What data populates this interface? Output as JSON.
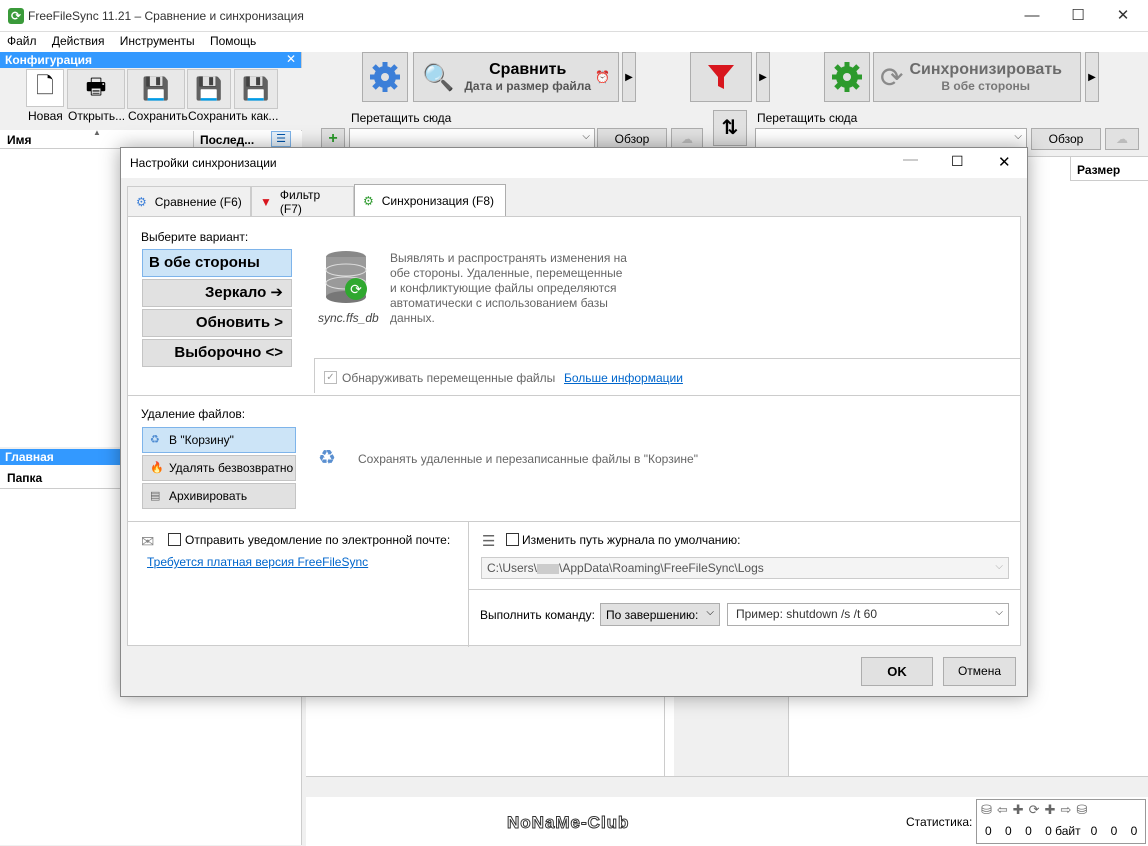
{
  "window": {
    "title": "FreeFileSync 11.21 – Сравнение и синхронизация",
    "minimize": "—",
    "maximize": "☐",
    "close": "✕"
  },
  "menu": [
    "Файл",
    "Действия",
    "Инструменты",
    "Помощь"
  ],
  "config": {
    "title": "Конфигурация",
    "close": "✕",
    "buttons": [
      {
        "label": "Новая"
      },
      {
        "label": "Открыть..."
      },
      {
        "label": "Сохранить"
      },
      {
        "label": "Сохранить как..."
      }
    ],
    "col_name": "Имя",
    "col_last": "Послед..."
  },
  "main_panel": {
    "title": "Главная",
    "col_folder": "Папка"
  },
  "toolbar": {
    "compare_title": "Сравнить",
    "compare_sub": "Дата и размер файла",
    "sync_title": "Синхронизировать",
    "sync_sub": "В обе стороны"
  },
  "left_folder": {
    "drop_label": "Перетащить сюда",
    "browse": "Обзор"
  },
  "right_folder": {
    "drop_label": "Перетащить сюда",
    "browse": "Обзор"
  },
  "grid": {
    "col_size": "Размер"
  },
  "status": {
    "label": "Статистика:",
    "counts": [
      "0",
      "0",
      "0",
      "0 байт",
      "0",
      "0",
      "0"
    ]
  },
  "watermark": "NoNaMe-Club",
  "dialog": {
    "title": "Настройки синхронизации",
    "tabs": [
      {
        "label": "Сравнение (F6)"
      },
      {
        "label": "Фильтр (F7)"
      },
      {
        "label": "Синхронизация (F8)"
      }
    ],
    "variant_label": "Выберите вариант:",
    "variants": [
      {
        "label": "В обе стороны ⟷"
      },
      {
        "label": "Зеркало ➔"
      },
      {
        "label": "Обновить >"
      },
      {
        "label": "Выборочно <>"
      }
    ],
    "db_name": "sync.ffs_db",
    "description": "Выявлять и распространять изменения на обе стороны. Удаленные, перемещенные и конфликтующие файлы определяются автоматически с использованием базы данных.",
    "detect_moved": "Обнаруживать перемещенные файлы",
    "more_info": "Больше информации",
    "delete_label": "Удаление файлов:",
    "delete_options": [
      {
        "label": "В \"Корзину\""
      },
      {
        "label": "Удалять безвозвратно"
      },
      {
        "label": "Архивировать"
      }
    ],
    "delete_desc": "Сохранять удаленные и перезаписанные файлы в \"Корзине\"",
    "email_label": "Отправить уведомление по электронной почте:",
    "paid_link": "Требуется платная версия FreeFileSync",
    "log_label": "Изменить путь журнала по умолчанию:",
    "log_path_a": "C:\\Users\\",
    "log_path_b": "\\AppData\\Roaming\\FreeFileSync\\Logs",
    "run_label": "Выполнить команду:",
    "run_when": "По завершению:",
    "run_example": "Пример: shutdown /s /t 60",
    "ok": "OK",
    "cancel": "Отмена"
  }
}
